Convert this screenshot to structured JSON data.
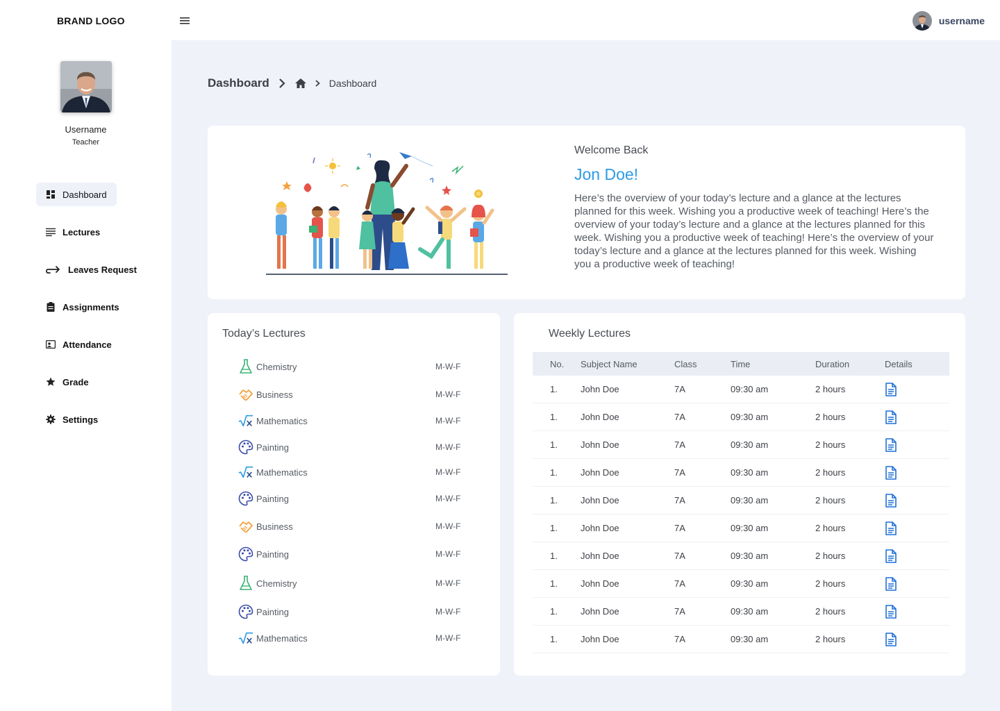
{
  "brand": "BRAND LOGO",
  "topbar": {
    "username": "username",
    "menu_icon": "hamburger-icon"
  },
  "profile": {
    "name": "Username",
    "role": "Teacher"
  },
  "nav": [
    {
      "label": "Dashboard",
      "icon": "dashboard-icon",
      "active": true
    },
    {
      "label": "Lectures",
      "icon": "lines-icon"
    },
    {
      "label": "Leaves Request",
      "icon": "redirect-arrow-icon"
    },
    {
      "label": "Assignments",
      "icon": "clipboard-icon"
    },
    {
      "label": "Attendance",
      "icon": "id-card-icon"
    },
    {
      "label": "Grade",
      "icon": "star-icon"
    },
    {
      "label": "Settings",
      "icon": "gear-icon"
    }
  ],
  "breadcrumb": {
    "title": "Dashboard",
    "current": "Dashboard"
  },
  "welcome": {
    "label": "Welcome Back",
    "name": "Jon Doe!",
    "text": "Here’s the overview of your today’s lecture and a glance at the lectures planned for this week. Wishing you a productive week of teaching! Here’s the overview of your today’s lecture and a glance at the lectures planned for this week. Wishing you a productive week of teaching! Here’s the overview of your today’s lecture and a glance at the lectures planned for this week. Wishing you a productive week of teaching!"
  },
  "today": {
    "title": "Today’s Lectures",
    "items": [
      {
        "name": "Chemistry",
        "days": "M-W-F",
        "icon": "flask-icon"
      },
      {
        "name": "Business",
        "days": "M-W-F",
        "icon": "handshake-icon"
      },
      {
        "name": "Mathematics",
        "days": "M-W-F",
        "icon": "square-root-icon"
      },
      {
        "name": "Painting",
        "days": "M-W-F",
        "icon": "palette-icon"
      },
      {
        "name": "Mathematics",
        "days": "M-W-F",
        "icon": "square-root-icon"
      },
      {
        "name": "Painting",
        "days": "M-W-F",
        "icon": "palette-icon"
      },
      {
        "name": "Business",
        "days": "M-W-F",
        "icon": "handshake-icon"
      },
      {
        "name": "Painting",
        "days": "M-W-F",
        "icon": "palette-icon"
      },
      {
        "name": "Chemistry",
        "days": "M-W-F",
        "icon": "flask-icon"
      },
      {
        "name": "Painting",
        "days": "M-W-F",
        "icon": "palette-icon"
      },
      {
        "name": "Mathematics",
        "days": "M-W-F",
        "icon": "square-root-icon"
      }
    ]
  },
  "weekly": {
    "title": "Weekly Lectures",
    "columns": [
      "No.",
      "Subject Name",
      "Class",
      "Time",
      "Duration",
      "Details"
    ],
    "rows": [
      {
        "no": "1.",
        "subject": "John Doe",
        "class": "7A",
        "time": "09:30 am",
        "duration": "2 hours"
      },
      {
        "no": "1.",
        "subject": "John Doe",
        "class": "7A",
        "time": "09:30 am",
        "duration": "2 hours"
      },
      {
        "no": "1.",
        "subject": "John Doe",
        "class": "7A",
        "time": "09:30 am",
        "duration": "2 hours"
      },
      {
        "no": "1.",
        "subject": "John Doe",
        "class": "7A",
        "time": "09:30 am",
        "duration": "2 hours"
      },
      {
        "no": "1.",
        "subject": "John Doe",
        "class": "7A",
        "time": "09:30 am",
        "duration": "2 hours"
      },
      {
        "no": "1.",
        "subject": "John Doe",
        "class": "7A",
        "time": "09:30 am",
        "duration": "2 hours"
      },
      {
        "no": "1.",
        "subject": "John Doe",
        "class": "7A",
        "time": "09:30 am",
        "duration": "2 hours"
      },
      {
        "no": "1.",
        "subject": "John Doe",
        "class": "7A",
        "time": "09:30 am",
        "duration": "2 hours"
      },
      {
        "no": "1.",
        "subject": "John Doe",
        "class": "7A",
        "time": "09:30 am",
        "duration": "2 hours"
      },
      {
        "no": "1.",
        "subject": "John Doe",
        "class": "7A",
        "time": "09:30 am",
        "duration": "2 hours"
      }
    ]
  },
  "colors": {
    "accent": "#2c9be5",
    "background": "#eff2f9",
    "doc_icon": "#1f6fd6"
  }
}
